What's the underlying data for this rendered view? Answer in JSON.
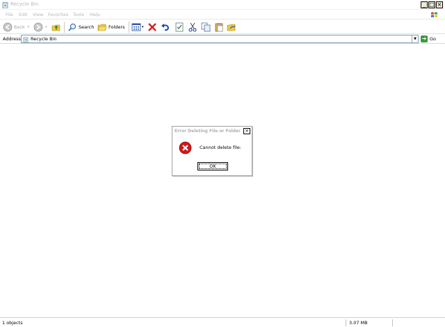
{
  "window": {
    "title": "Recycle Bin",
    "minimize": "_",
    "maximize": "□",
    "close": "×"
  },
  "menu": [
    "File",
    "Edit",
    "View",
    "Favorites",
    "Tools",
    "Help"
  ],
  "toolbar": {
    "back_label": "Back",
    "search_label": "Search",
    "folders_label": "Folders",
    "icons": [
      "back-icon",
      "forward-icon",
      "up-folder-icon",
      "search-icon",
      "folders-icon",
      "views-icon",
      "delete-icon",
      "undo-icon",
      "properties-icon",
      "cut-icon",
      "copy-icon",
      "paste-icon",
      "folder-options-icon"
    ]
  },
  "address": {
    "label": "Address",
    "value": "Recycle Bin",
    "go_label": "Go"
  },
  "dialog": {
    "title": "Error Deleting File or Folder",
    "close": "×",
    "message": "Cannot delete file:",
    "ok_label": "OK",
    "icon": "error-icon"
  },
  "status": {
    "objects": "1 objects",
    "size": "3.07 MB"
  },
  "colors": {
    "error_red": "#cc1a1a",
    "go_green": "#3a9a3a",
    "disabled_text": "#b8b8b8"
  }
}
